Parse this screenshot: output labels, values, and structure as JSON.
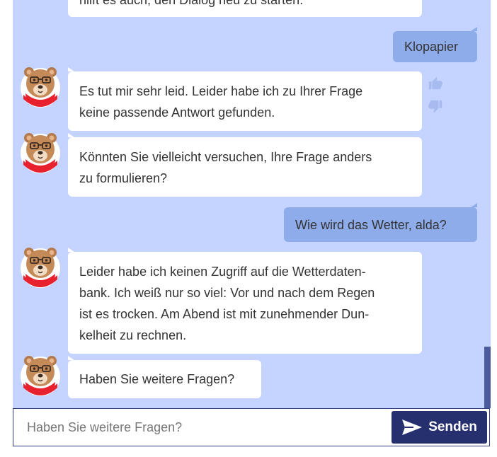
{
  "messages": [
    {
      "sender": "bot",
      "text": "hilft es auch, den Dialog neu zu starten."
    },
    {
      "sender": "user",
      "text": "Klopapier"
    },
    {
      "sender": "bot",
      "lines": [
        "Es tut mir sehr leid. Leider habe ich zu Ihrer Frage",
        "keine passende Antwort gefunden."
      ]
    },
    {
      "sender": "bot",
      "lines": [
        "Könnten Sie vielleicht versuchen, Ihre Frage anders",
        "zu formulieren?"
      ]
    },
    {
      "sender": "user",
      "text": "Wie wird das Wetter, alda?"
    },
    {
      "sender": "bot",
      "lines": [
        "Leider habe ich keinen Zugriff auf die Wetterdaten-",
        "bank. Ich weiß nur so viel: Vor und nach dem Regen",
        "ist es trocken. Am Abend ist mit zunehmender Dun-",
        "kelheit zu rechnen."
      ]
    },
    {
      "sender": "bot",
      "text": "Haben Sie weitere Fragen?"
    }
  ],
  "feedback": {
    "up_icon": "thumbs-up-icon",
    "down_icon": "thumbs-down-icon"
  },
  "composer": {
    "placeholder": "Haben Sie weitere Fragen?",
    "value": ""
  },
  "send_button": {
    "label": "Senden",
    "icon": "send-icon"
  },
  "avatar": {
    "icon": "bear-avatar-icon"
  },
  "colors": {
    "chat_background": "#c4d3ff",
    "bot_bubble": "#ffffff",
    "user_bubble": "#8eabea",
    "send_button": "#27306f",
    "scrollbar": "#4c5b9e"
  }
}
